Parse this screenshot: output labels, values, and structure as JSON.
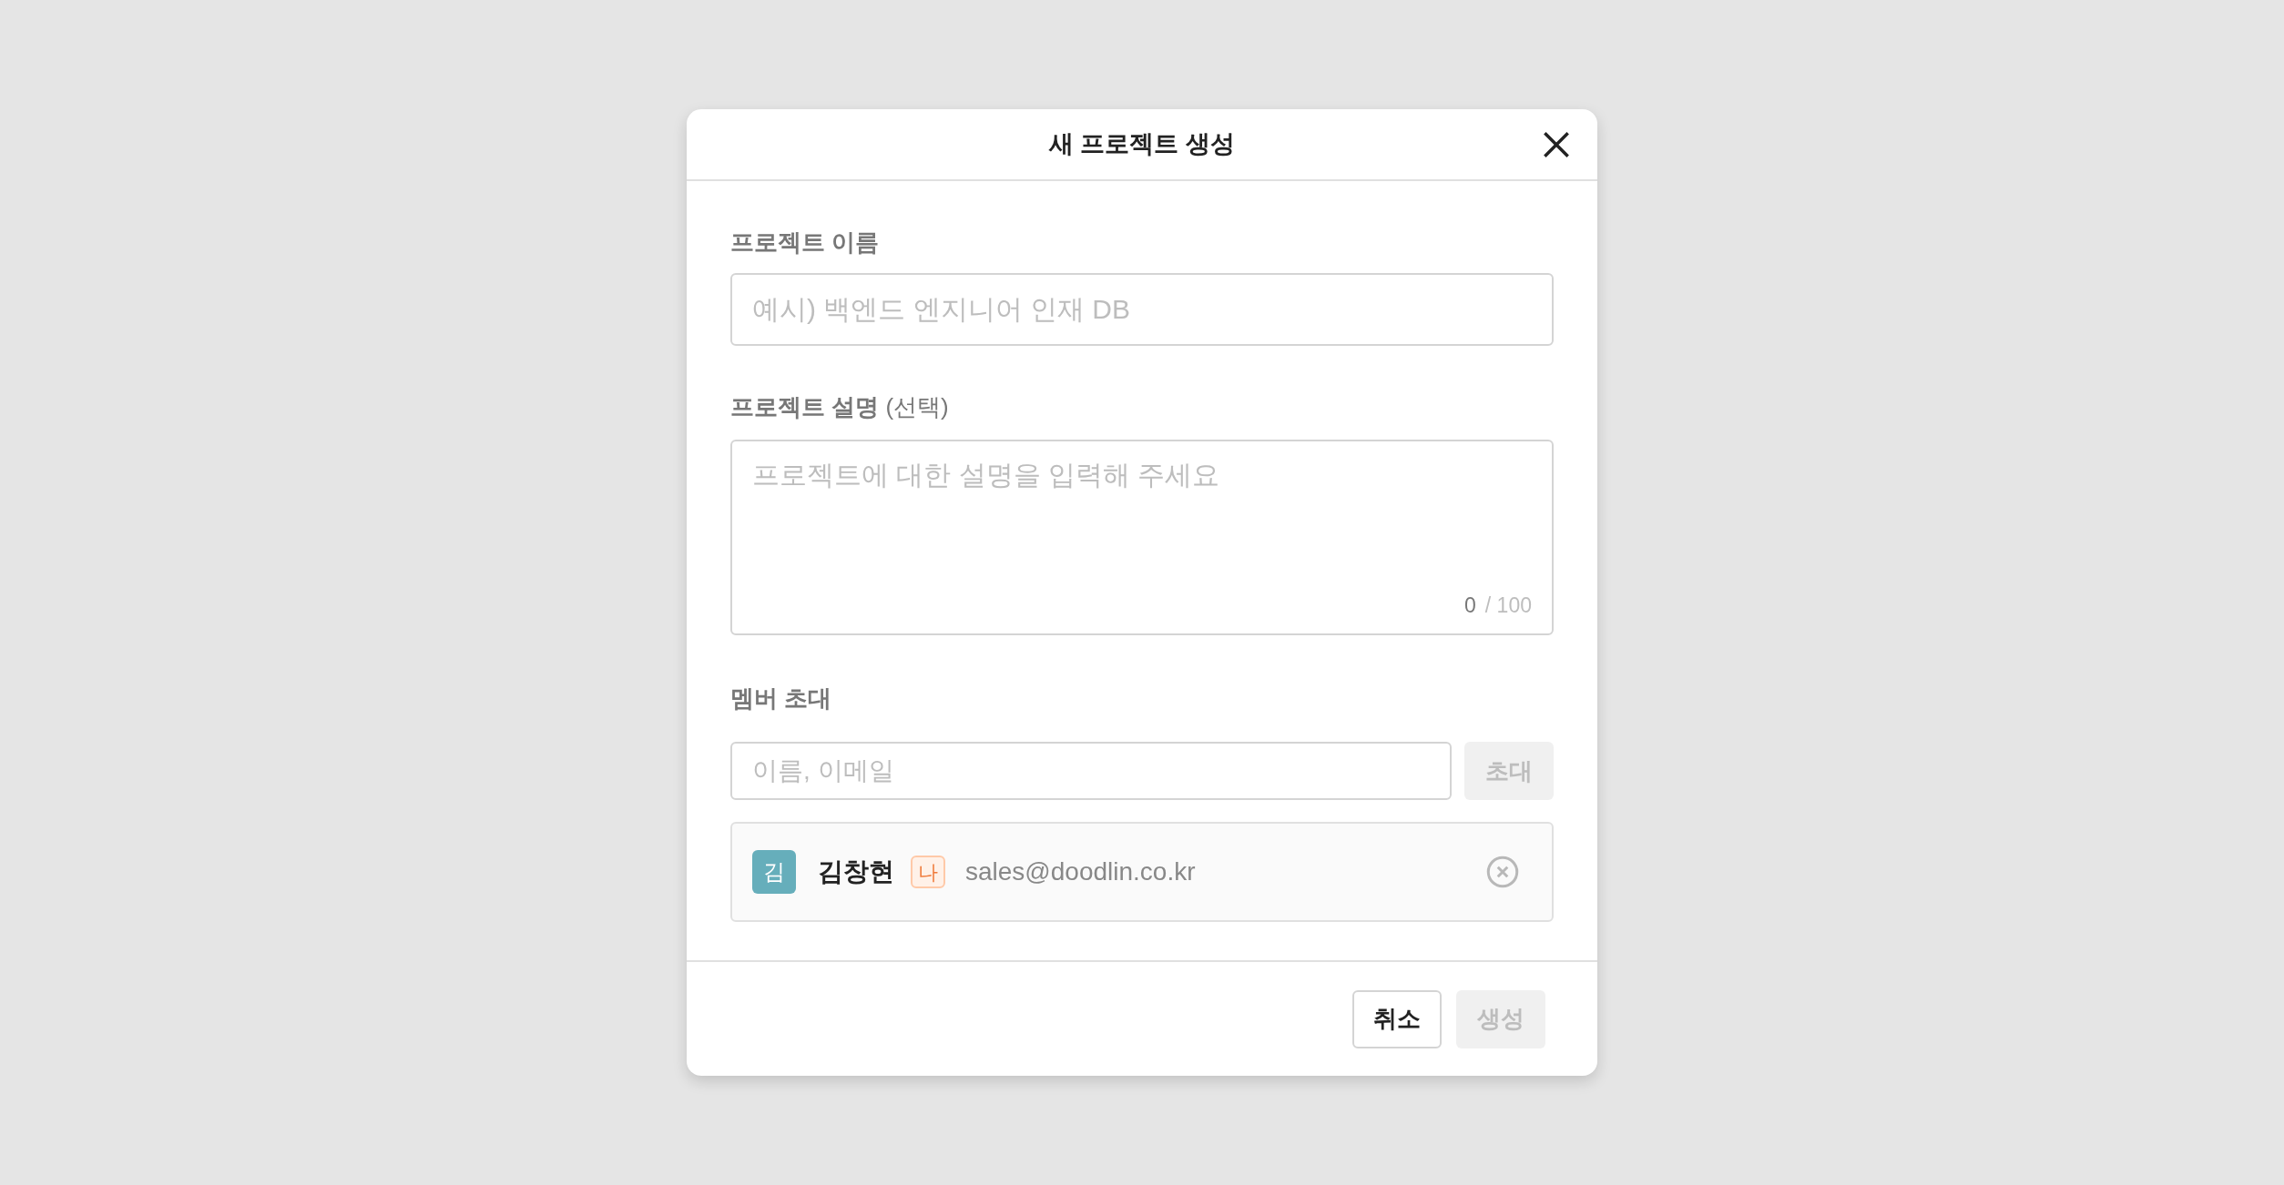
{
  "dialog": {
    "title": "새 프로젝트 생성"
  },
  "name_field": {
    "label": "프로젝트 이름",
    "placeholder": "예시) 백엔드 엔지니어 인재 DB"
  },
  "description_field": {
    "label": "**프로젝트 설명** (선택)",
    "placeholder": "프로젝트에 대한 설명을 입력해 주세요",
    "count": "0",
    "max": "/ 100"
  },
  "invite": {
    "label": "멤버 초대",
    "placeholder": "이름, 이메일",
    "button": {
      "label": "초대",
      "disabled": true
    }
  },
  "members": [
    {
      "initial": "김",
      "color": "#66aebb",
      "name": "김창현",
      "badge": "나",
      "email": "sales@doodlin.co.kr"
    }
  ],
  "buttons": [
    {
      "label": "취소",
      "disabled": false
    },
    {
      "label": "생성",
      "disabled": true
    }
  ]
}
